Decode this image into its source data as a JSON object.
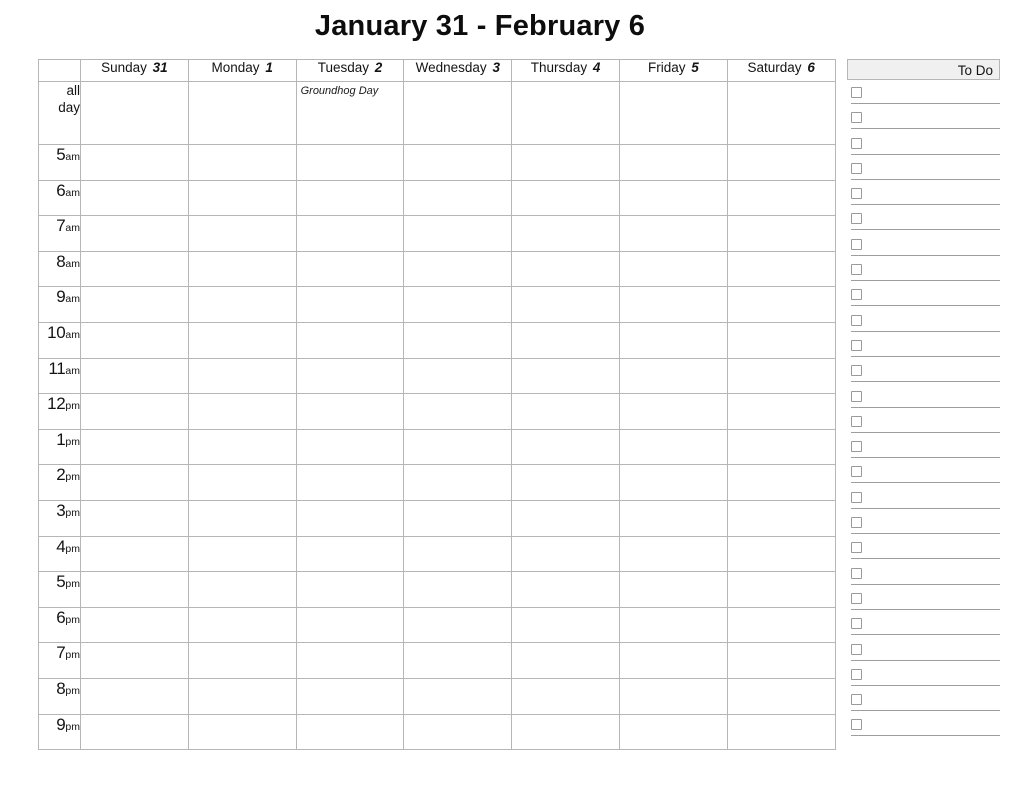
{
  "page": {
    "title": "January 31 - February 6"
  },
  "calendar": {
    "corner_label": "",
    "days": [
      {
        "name": "Sunday",
        "number": "31"
      },
      {
        "name": "Monday",
        "number": "1"
      },
      {
        "name": "Tuesday",
        "number": "2"
      },
      {
        "name": "Wednesday",
        "number": "3"
      },
      {
        "name": "Thursday",
        "number": "4"
      },
      {
        "name": "Friday",
        "number": "5"
      },
      {
        "name": "Saturday",
        "number": "6"
      }
    ],
    "all_day": {
      "label_line1": "all",
      "label_line2": "day",
      "events": [
        "",
        "",
        "Groundhog Day",
        "",
        "",
        "",
        ""
      ]
    },
    "hours": [
      {
        "num": "5",
        "suffix": "am"
      },
      {
        "num": "6",
        "suffix": "am"
      },
      {
        "num": "7",
        "suffix": "am"
      },
      {
        "num": "8",
        "suffix": "am"
      },
      {
        "num": "9",
        "suffix": "am"
      },
      {
        "num": "10",
        "suffix": "am"
      },
      {
        "num": "11",
        "suffix": "am"
      },
      {
        "num": "12",
        "suffix": "pm"
      },
      {
        "num": "1",
        "suffix": "pm"
      },
      {
        "num": "2",
        "suffix": "pm"
      },
      {
        "num": "3",
        "suffix": "pm"
      },
      {
        "num": "4",
        "suffix": "pm"
      },
      {
        "num": "5",
        "suffix": "pm"
      },
      {
        "num": "6",
        "suffix": "pm"
      },
      {
        "num": "7",
        "suffix": "pm"
      },
      {
        "num": "8",
        "suffix": "pm"
      },
      {
        "num": "9",
        "suffix": "pm"
      }
    ]
  },
  "todo": {
    "header_label": "To Do",
    "item_count": 26,
    "items": [
      {
        "label": "",
        "checked": false
      },
      {
        "label": "",
        "checked": false
      },
      {
        "label": "",
        "checked": false
      },
      {
        "label": "",
        "checked": false
      },
      {
        "label": "",
        "checked": false
      },
      {
        "label": "",
        "checked": false
      },
      {
        "label": "",
        "checked": false
      },
      {
        "label": "",
        "checked": false
      },
      {
        "label": "",
        "checked": false
      },
      {
        "label": "",
        "checked": false
      },
      {
        "label": "",
        "checked": false
      },
      {
        "label": "",
        "checked": false
      },
      {
        "label": "",
        "checked": false
      },
      {
        "label": "",
        "checked": false
      },
      {
        "label": "",
        "checked": false
      },
      {
        "label": "",
        "checked": false
      },
      {
        "label": "",
        "checked": false
      },
      {
        "label": "",
        "checked": false
      },
      {
        "label": "",
        "checked": false
      },
      {
        "label": "",
        "checked": false
      },
      {
        "label": "",
        "checked": false
      },
      {
        "label": "",
        "checked": false
      },
      {
        "label": "",
        "checked": false
      },
      {
        "label": "",
        "checked": false
      },
      {
        "label": "",
        "checked": false
      },
      {
        "label": "",
        "checked": false
      }
    ]
  },
  "colors": {
    "grid_border": "#b6b6b6",
    "header_fill": "#f0f0f0",
    "text": "#141414",
    "line": "#9d9d9d",
    "checkbox_border": "#9a9a9a"
  }
}
